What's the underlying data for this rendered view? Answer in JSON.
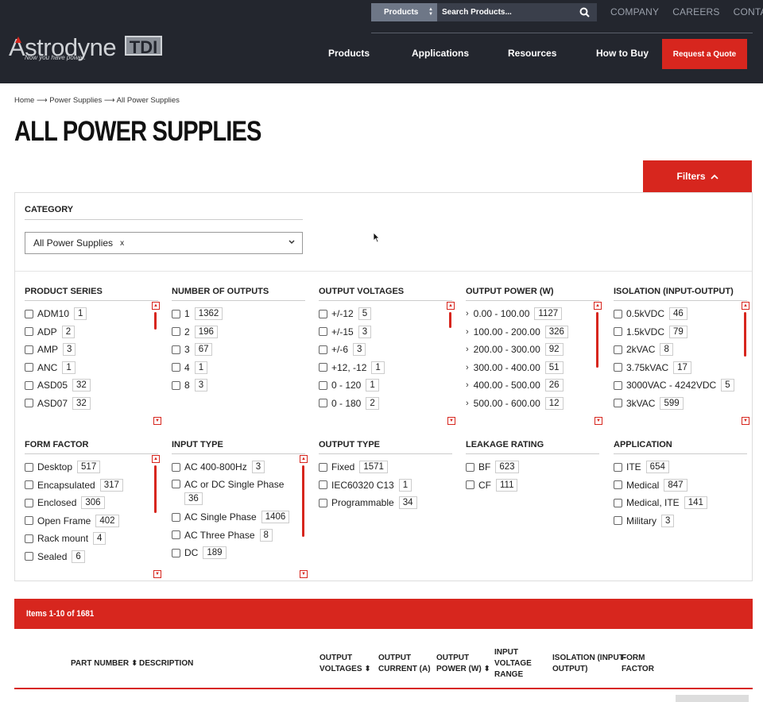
{
  "header": {
    "search": {
      "category": "Products",
      "placeholder": "Search Products..."
    },
    "top_links": [
      "COMPANY",
      "CAREERS",
      "CONTACT"
    ],
    "logo": {
      "name": "Astrodyne",
      "mark": "TDI",
      "tagline": "Now you have power."
    },
    "nav": [
      "Products",
      "Applications",
      "Resources",
      "How to Buy"
    ],
    "quote_button": "Request a Quote"
  },
  "breadcrumb": {
    "items": [
      "Home",
      "Power Supplies",
      "All Power Supplies"
    ],
    "separator": "⟶"
  },
  "page_title": "ALL POWER SUPPLIES",
  "filters_button": "Filters",
  "category": {
    "label": "CATEGORY",
    "selected": "All Power Supplies",
    "remove": "x"
  },
  "filters": {
    "product_series": {
      "title": "PRODUCT SERIES",
      "options": [
        {
          "label": "ADM10",
          "count": "1"
        },
        {
          "label": "ADP",
          "count": "2"
        },
        {
          "label": "AMP",
          "count": "3"
        },
        {
          "label": "ANC",
          "count": "1"
        },
        {
          "label": "ASD05",
          "count": "32"
        },
        {
          "label": "ASD07",
          "count": "32"
        }
      ]
    },
    "number_of_outputs": {
      "title": "NUMBER OF OUTPUTS",
      "options": [
        {
          "label": "1",
          "count": "1362"
        },
        {
          "label": "2",
          "count": "196"
        },
        {
          "label": "3",
          "count": "67"
        },
        {
          "label": "4",
          "count": "1"
        },
        {
          "label": "8",
          "count": "3"
        }
      ]
    },
    "output_voltages": {
      "title": "OUTPUT VOLTAGES",
      "options": [
        {
          "label": "+/-12",
          "count": "5"
        },
        {
          "label": "+/-15",
          "count": "3"
        },
        {
          "label": "+/-6",
          "count": "3"
        },
        {
          "label": "+12, -12",
          "count": "1"
        },
        {
          "label": "0 - 120",
          "count": "1"
        },
        {
          "label": "0 - 180",
          "count": "2"
        }
      ]
    },
    "output_power": {
      "title": "OUTPUT POWER (W)",
      "options": [
        {
          "label": "0.00 - 100.00",
          "count": "1127"
        },
        {
          "label": "100.00 - 200.00",
          "count": "326"
        },
        {
          "label": "200.00 - 300.00",
          "count": "92"
        },
        {
          "label": "300.00 - 400.00",
          "count": "51"
        },
        {
          "label": "400.00 - 500.00",
          "count": "26"
        },
        {
          "label": "500.00 - 600.00",
          "count": "12"
        }
      ]
    },
    "isolation": {
      "title": "ISOLATION (INPUT-OUTPUT)",
      "options": [
        {
          "label": "0.5kVDC",
          "count": "46"
        },
        {
          "label": "1.5kVDC",
          "count": "79"
        },
        {
          "label": "2kVAC",
          "count": "8"
        },
        {
          "label": "3.75kVAC",
          "count": "17"
        },
        {
          "label": "3000VAC - 4242VDC",
          "count": "5"
        },
        {
          "label": "3kVAC",
          "count": "599"
        }
      ]
    },
    "form_factor": {
      "title": "FORM FACTOR",
      "options": [
        {
          "label": "Desktop",
          "count": "517"
        },
        {
          "label": "Encapsulated",
          "count": "317"
        },
        {
          "label": "Enclosed",
          "count": "306"
        },
        {
          "label": "Open Frame",
          "count": "402"
        },
        {
          "label": "Rack mount",
          "count": "4"
        },
        {
          "label": "Sealed",
          "count": "6"
        }
      ]
    },
    "input_type": {
      "title": "INPUT TYPE",
      "options": [
        {
          "label": "AC 400-800Hz",
          "count": "3"
        },
        {
          "label": "AC or DC Single Phase",
          "count": "36"
        },
        {
          "label": "AC Single Phase",
          "count": "1406"
        },
        {
          "label": "AC Three Phase",
          "count": "8"
        },
        {
          "label": "DC",
          "count": "189"
        }
      ]
    },
    "output_type": {
      "title": "OUTPUT TYPE",
      "options": [
        {
          "label": "Fixed",
          "count": "1571"
        },
        {
          "label": "IEC60320 C13",
          "count": "1"
        },
        {
          "label": "Programmable",
          "count": "34"
        }
      ]
    },
    "leakage_rating": {
      "title": "LEAKAGE RATING",
      "options": [
        {
          "label": "BF",
          "count": "623"
        },
        {
          "label": "CF",
          "count": "111"
        }
      ]
    },
    "application": {
      "title": "APPLICATION",
      "options": [
        {
          "label": "ITE",
          "count": "654"
        },
        {
          "label": "Medical",
          "count": "847"
        },
        {
          "label": "Medical, ITE",
          "count": "141"
        },
        {
          "label": "Military",
          "count": "3"
        }
      ]
    }
  },
  "results": {
    "summary": "Items 1-10 of 1681",
    "columns": {
      "part_number": "PART NUMBER",
      "description": "DESCRIPTION",
      "output_voltages": [
        "OUTPUT",
        "VOLTAGES"
      ],
      "output_current": [
        "OUTPUT",
        "CURRENT (A)"
      ],
      "output_power": [
        "OUTPUT",
        "POWER (W)"
      ],
      "input_voltage": [
        "INPUT",
        "VOLTAGE",
        "RANGE"
      ],
      "isolation": [
        "ISOLATION (INPUT-",
        "OUTPUT)"
      ],
      "form_factor": [
        "FORM",
        "FACTOR"
      ]
    },
    "sort_glyph": "⬍"
  },
  "colors": {
    "accent": "#d7261e",
    "header_bg": "#23262e"
  }
}
